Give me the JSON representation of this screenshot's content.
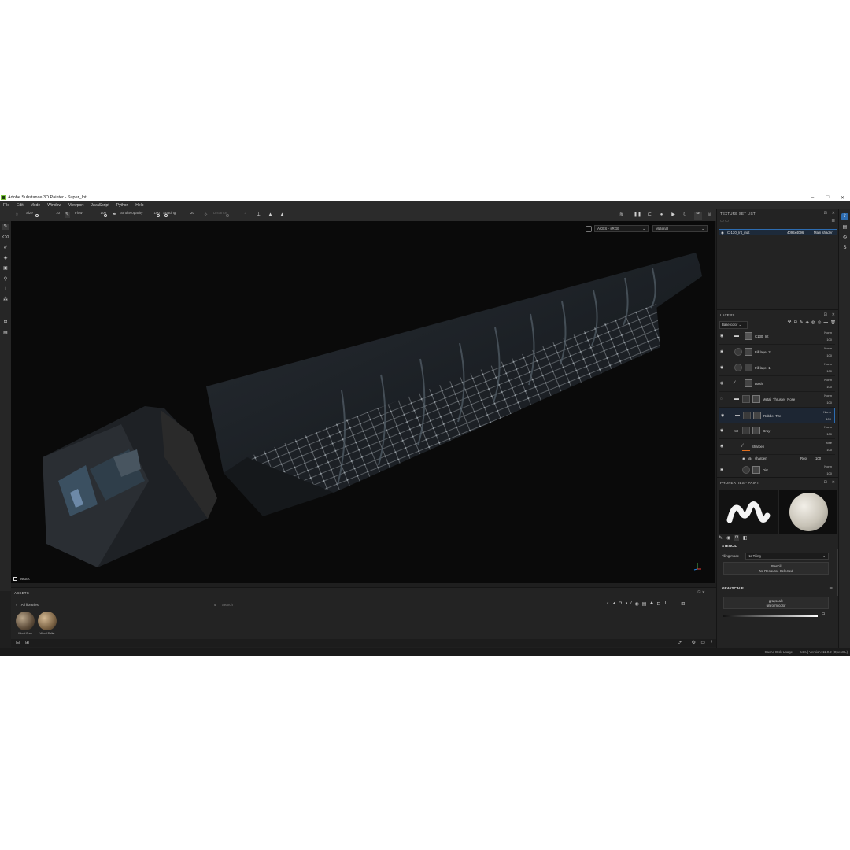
{
  "window": {
    "title": "Adobe Substance 3D Painter - Super_Int",
    "controls": [
      "–",
      "□",
      "✕"
    ]
  },
  "menu": [
    "File",
    "Edit",
    "Mode",
    "Window",
    "Viewport",
    "JavaScript",
    "Python",
    "Help"
  ],
  "tool_options": {
    "size_label": "Size",
    "size_value": "10",
    "flow_label": "Flow",
    "flow_value": "100",
    "stroke_opacity_label": "Stroke opacity",
    "stroke_opacity_value": "100",
    "spacing_label": "Spacing",
    "spacing_value": "20",
    "distance_label": "Distance",
    "distance_value": "3"
  },
  "viewport": {
    "colorspace": "ACES - sRGB",
    "display_mode": "Material",
    "mask_label": "MASK"
  },
  "texture_set_list": {
    "title": "TEXTURE SET LIST",
    "row": {
      "name": "C-130_Int_mat",
      "resolution": "4096x4096",
      "shader": "Main shader"
    }
  },
  "layers": {
    "title": "LAYERS",
    "channel": "Base color",
    "items": [
      {
        "name": "C130_Int",
        "blend": "Norm",
        "opacity": "100",
        "type": "fill"
      },
      {
        "name": "Fill layer 2",
        "blend": "Norm",
        "opacity": "100",
        "type": "fill"
      },
      {
        "name": "Fill layer 1",
        "blend": "Norm",
        "opacity": "100",
        "type": "fill"
      },
      {
        "name": "Dash",
        "blend": "Norm",
        "opacity": "100",
        "type": "paint"
      },
      {
        "name": "Metal_Thruster_Nose",
        "blend": "Norm",
        "opacity": "100",
        "type": "folder"
      },
      {
        "name": "Rubber Tire",
        "blend": "Norm",
        "opacity": "100",
        "type": "folder"
      },
      {
        "name": "Gray",
        "blend": "Norm",
        "opacity": "100",
        "type": "folder"
      },
      {
        "name": "Sharpen",
        "blend": "Mlte",
        "opacity": "100",
        "type": "paint"
      },
      {
        "name": "Dirt",
        "blend": "Norm",
        "opacity": "100",
        "type": "fill"
      }
    ],
    "effect": {
      "name": "sharpen",
      "blend": "Repl",
      "opacity": "100"
    }
  },
  "properties": {
    "title": "PROPERTIES - PAINT",
    "stencil_title": "STENCIL",
    "tiling_label": "Tiling mode",
    "tiling_value": "No Tiling",
    "stencil_box_title": "Stencil",
    "stencil_box_sub": "No Resource Selected",
    "grayscale_title": "GRAYSCALE",
    "grayscale_box_title": "grayscale",
    "grayscale_box_sub": "uniform color"
  },
  "assets": {
    "title": "ASSETS",
    "library": "All libraries",
    "search_placeholder": "Search",
    "items": [
      {
        "name": "Wood Burn"
      },
      {
        "name": "Wood Pallet"
      }
    ]
  },
  "status": {
    "cache": "Cache Disk Usage:",
    "version": "64% | Version: 11.0.2 (OpenGL)"
  },
  "colors": {
    "accent": "#2d6cb0",
    "panel": "#232323",
    "viewport_bg": "#0a0a0a"
  }
}
